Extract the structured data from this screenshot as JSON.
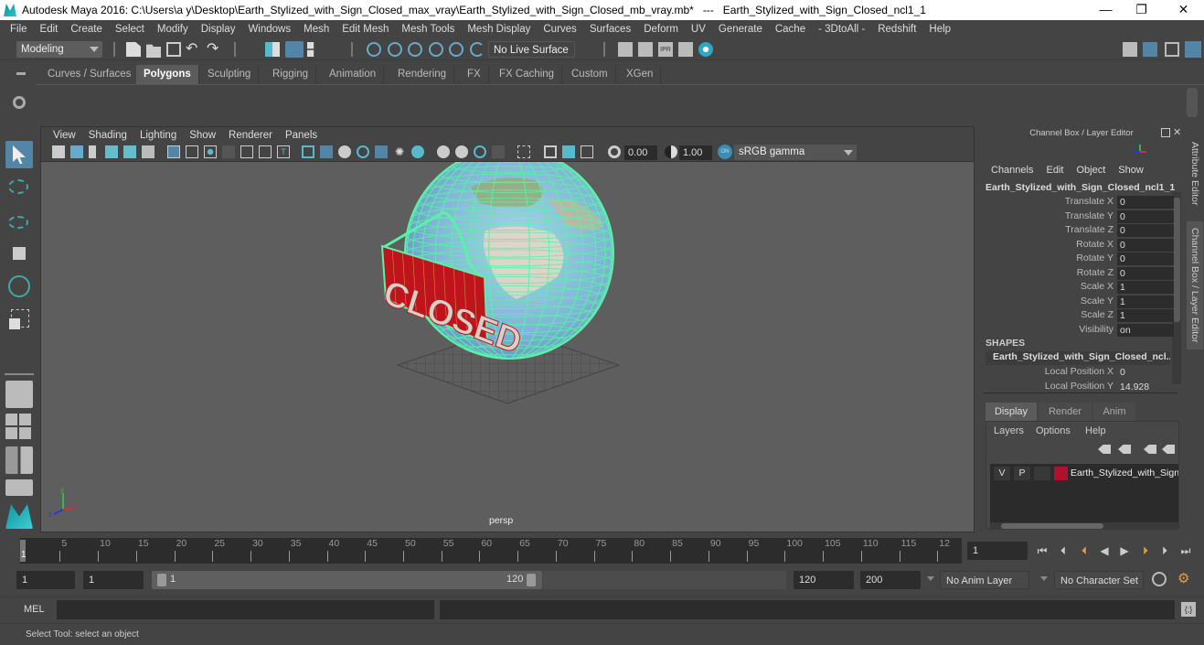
{
  "window": {
    "title": "Autodesk Maya 2016: C:\\Users\\a y\\Desktop\\Earth_Stylized_with_Sign_Closed_max_vray\\Earth_Stylized_with_Sign_Closed_mb_vray.mb*   ---   Earth_Stylized_with_Sign_Closed_ncl1_1",
    "minimize": "—",
    "maximize": "❐",
    "close": "✕"
  },
  "menubar": [
    "File",
    "Edit",
    "Create",
    "Select",
    "Modify",
    "Display",
    "Windows",
    "Mesh",
    "Edit Mesh",
    "Mesh Tools",
    "Mesh Display",
    "Curves",
    "Surfaces",
    "Deform",
    "UV",
    "Generate",
    "Cache",
    "- 3DtoAll -",
    "Redshift",
    "Help"
  ],
  "statusline": {
    "mode": "Modeling",
    "live_surface": "No Live Surface"
  },
  "shelf": {
    "tabs": [
      "Curves / Surfaces",
      "Polygons",
      "Sculpting",
      "Rigging",
      "Animation",
      "Rendering",
      "FX",
      "FX Caching",
      "Custom",
      "XGen"
    ],
    "active_tab": "Polygons",
    "icons": [
      "poly-sphere-icon",
      "poly-cube-icon",
      "poly-cylinder-icon",
      "poly-cone-icon",
      "poly-plane-icon",
      "poly-torus-icon",
      "poly-pyramid-icon",
      "poly-pipe-icon",
      "combine-icon",
      "separate-icon",
      "mirror-icon",
      "smooth-icon",
      "bevel-icon",
      "bridge-icon",
      "multi-cut-icon",
      "extrude-icon",
      "merge-icon",
      "fill-hole-icon",
      "insert-edge-loop-icon",
      "offset-edge-loop-icon",
      "collapse-icon",
      "triangulate-icon",
      "quadrangulate-icon",
      "uv-planar-icon",
      "uv-cylindrical-icon",
      "uv-spherical-icon",
      "uv-auto-icon",
      "uv-contour-icon",
      "uv-editor-icon",
      "uv-unfold-icon"
    ]
  },
  "viewport": {
    "menus": [
      "View",
      "Shading",
      "Lighting",
      "Show",
      "Renderer",
      "Panels"
    ],
    "exposure": "0.00",
    "gamma": "1.00",
    "color_space": "sRGB gamma",
    "camera_label": "persp",
    "sign_text": "CLOSED",
    "axis": {
      "x": "x",
      "y": "y",
      "z": "z"
    }
  },
  "channel_box": {
    "title": "Channel Box / Layer Editor",
    "menus": [
      "Channels",
      "Edit",
      "Object",
      "Show"
    ],
    "object_name": "Earth_Stylized_with_Sign_Closed_ncl1_1",
    "channels": [
      {
        "label": "Translate X",
        "value": "0"
      },
      {
        "label": "Translate Y",
        "value": "0"
      },
      {
        "label": "Translate Z",
        "value": "0"
      },
      {
        "label": "Rotate X",
        "value": "0"
      },
      {
        "label": "Rotate Y",
        "value": "0"
      },
      {
        "label": "Rotate Z",
        "value": "0"
      },
      {
        "label": "Scale X",
        "value": "1"
      },
      {
        "label": "Scale Y",
        "value": "1"
      },
      {
        "label": "Scale Z",
        "value": "1"
      },
      {
        "label": "Visibility",
        "value": "on"
      }
    ],
    "shapes_header": "SHAPES",
    "shape_name": "Earth_Stylized_with_Sign_Closed_ncl...",
    "shape_channels": [
      {
        "label": "Local Position X",
        "value": "0"
      },
      {
        "label": "Local Position Y",
        "value": "14.928"
      }
    ]
  },
  "layer_editor": {
    "tabs": [
      "Display",
      "Render",
      "Anim"
    ],
    "active_tab": "Display",
    "menus": [
      "Layers",
      "Options",
      "Help"
    ],
    "layers": [
      {
        "v": "V",
        "p": "P",
        "color": "#b0122e",
        "name": "Earth_Stylized_with_Sign"
      }
    ]
  },
  "side_tabs": [
    "Attribute Editor",
    "Channel Box / Layer Editor"
  ],
  "timeline": {
    "ticks": [
      "5",
      "10",
      "15",
      "20",
      "25",
      "30",
      "35",
      "40",
      "45",
      "50",
      "55",
      "60",
      "65",
      "70",
      "75",
      "80",
      "85",
      "90",
      "95",
      "100",
      "105",
      "110",
      "115",
      "12"
    ],
    "current_frame_marker": "1",
    "current_frame": "1"
  },
  "range": {
    "start": "1",
    "playback_start": "1",
    "slider_start": "1",
    "slider_end": "120",
    "playback_end": "120",
    "end": "200",
    "anim_layer": "No Anim Layer",
    "character_set": "No Character Set"
  },
  "command_line": {
    "label": "MEL",
    "value": "",
    "result": ""
  },
  "help_line": "Select Tool: select an object",
  "colors": {
    "accent": "#5285a6",
    "wireframe": "#5cf0a8",
    "sign_red": "#c0141c",
    "shelf_orange": "#e89a3c",
    "shelf_green": "#4fbf8c"
  }
}
